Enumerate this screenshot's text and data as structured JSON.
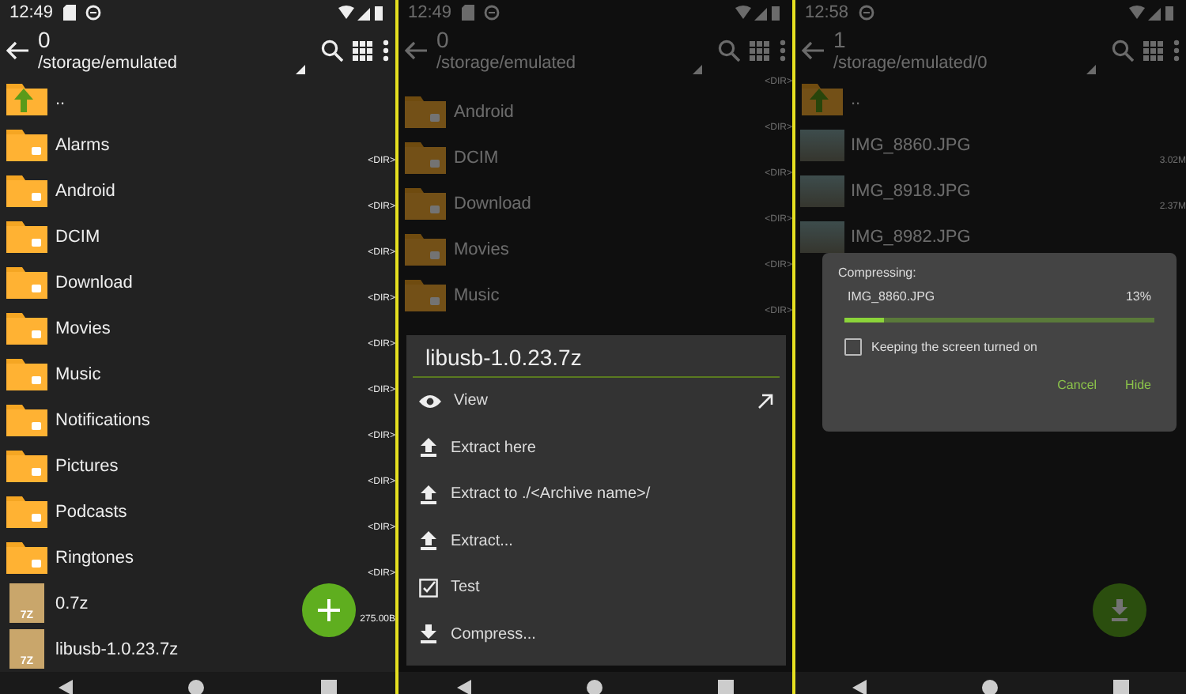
{
  "screens": [
    {
      "time": "12:49",
      "status_icons": [
        {
          "kind": "sdcard"
        },
        {
          "kind": "sync"
        }
      ],
      "count": "0",
      "path": "/storage/emulated",
      "dimmed": false,
      "fab": {
        "kind": "add"
      },
      "rows": [
        {
          "kind": "up",
          "name": ".."
        },
        {
          "kind": "folder",
          "name": "Alarms",
          "size": "<DIR>"
        },
        {
          "kind": "folder",
          "name": "Android",
          "size": "<DIR>"
        },
        {
          "kind": "folder",
          "name": "DCIM",
          "size": "<DIR>"
        },
        {
          "kind": "folder",
          "name": "Download",
          "size": "<DIR>"
        },
        {
          "kind": "folder",
          "name": "Movies",
          "size": "<DIR>"
        },
        {
          "kind": "folder",
          "name": "Music",
          "size": "<DIR>"
        },
        {
          "kind": "folder",
          "name": "Notifications",
          "size": "<DIR>"
        },
        {
          "kind": "folder",
          "name": "Pictures",
          "size": "<DIR>"
        },
        {
          "kind": "folder",
          "name": "Podcasts",
          "size": "<DIR>"
        },
        {
          "kind": "folder",
          "name": "Ringtones",
          "size": "<DIR>"
        },
        {
          "kind": "archive",
          "name": "0.7z",
          "icon_label": "7Z",
          "size": "275.00B"
        },
        {
          "kind": "archive",
          "name": "libusb-1.0.23.7z",
          "icon_label": "7Z"
        }
      ]
    },
    {
      "time": "12:49",
      "status_icons": [
        {
          "kind": "sdcard"
        },
        {
          "kind": "sync"
        }
      ],
      "count": "0",
      "path": "/storage/emulated",
      "dimmed": true,
      "rows": [
        {
          "kind": "partial",
          "size": "<DIR>"
        },
        {
          "kind": "folder",
          "name": "Android",
          "size": "<DIR>"
        },
        {
          "kind": "folder",
          "name": "DCIM",
          "size": "<DIR>"
        },
        {
          "kind": "folder",
          "name": "Download",
          "size": "<DIR>"
        },
        {
          "kind": "folder",
          "name": "Movies",
          "size": "<DIR>"
        },
        {
          "kind": "folder",
          "name": "Music",
          "size": "<DIR>"
        }
      ],
      "sheet": {
        "title": "libusb-1.0.23.7z",
        "items": [
          {
            "kind": "view",
            "label": "View"
          },
          {
            "kind": "extract",
            "label": "Extract here"
          },
          {
            "kind": "extract",
            "label": "Extract to ./<Archive name>/"
          },
          {
            "kind": "extract",
            "label": "Extract..."
          },
          {
            "kind": "test",
            "label": "Test"
          },
          {
            "kind": "compress",
            "label": "Compress..."
          }
        ]
      }
    },
    {
      "time": "12:58",
      "status_icons": [
        {
          "kind": "sync"
        }
      ],
      "count": "1",
      "path": "/storage/emulated/0",
      "dimmed": true,
      "fab": {
        "kind": "download"
      },
      "rows": [
        {
          "kind": "up",
          "name": ".."
        },
        {
          "kind": "image",
          "name": "IMG_8860.JPG",
          "size": "3.02M"
        },
        {
          "kind": "image",
          "name": "IMG_8918.JPG",
          "size": "2.37M"
        },
        {
          "kind": "image",
          "name": "IMG_8982.JPG"
        }
      ],
      "dialog": {
        "title": "Compressing:",
        "file": "IMG_8860.JPG",
        "percent": "13%",
        "level": 0.13,
        "checkbox": {
          "label": "Keeping the screen turned on",
          "checked": false
        },
        "buttons": [
          "Cancel",
          "Hide"
        ]
      }
    }
  ]
}
